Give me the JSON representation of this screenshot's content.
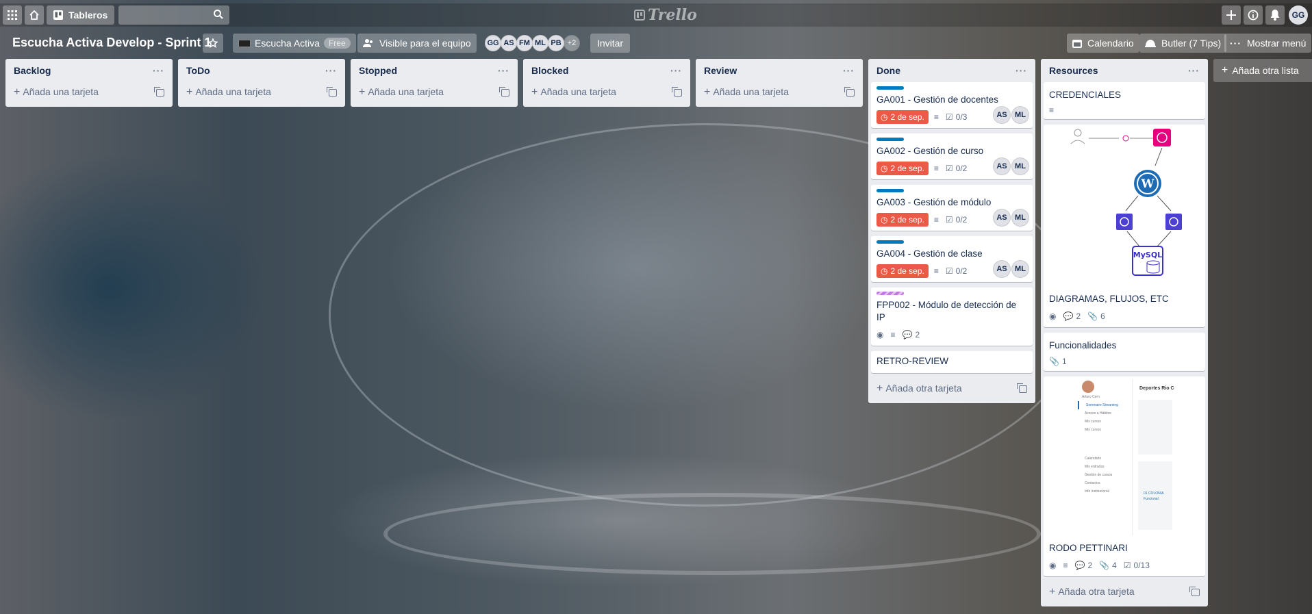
{
  "topbar": {
    "boards_label": "Tableros",
    "search_placeholder": "",
    "logo": "Trello",
    "user_initials": "GG"
  },
  "board": {
    "title": "Escucha Activa Develop - Sprint 1",
    "team_name": "Escucha Activa",
    "plan": "Free",
    "visibility": "Visible para el equipo",
    "members": [
      "GG",
      "AS",
      "FM",
      "ML",
      "PB"
    ],
    "members_more": "+2",
    "invite_label": "Invitar",
    "calendar_label": "Calendario",
    "butler_label": "Butler (7 Tips)",
    "menu_label": "Mostrar menú",
    "add_list_label": "Añada otra lista"
  },
  "colors": {
    "due_overdue": "#eb5a46",
    "label_blue": "#0079bf",
    "label_purple": "#c377e0"
  },
  "lists": [
    {
      "title": "Backlog",
      "add_label": "Añada una tarjeta"
    },
    {
      "title": "ToDo",
      "add_label": "Añada una tarjeta"
    },
    {
      "title": "Stopped",
      "add_label": "Añada una tarjeta"
    },
    {
      "title": "Blocked",
      "add_label": "Añada una tarjeta"
    },
    {
      "title": "Review",
      "add_label": "Añada una tarjeta"
    },
    {
      "title": "Done",
      "add_label": "Añada otra tarjeta",
      "cards": [
        {
          "title": "GA001 - Gestión de docentes",
          "due": "2 de sep.",
          "checklist": "0/3",
          "members": [
            "AS",
            "ML"
          ]
        },
        {
          "title": "GA002 - Gestión de curso",
          "due": "2 de sep.",
          "checklist": "0/2",
          "members": [
            "AS",
            "ML"
          ]
        },
        {
          "title": "GA003 - Gestión de módulo",
          "due": "2 de sep.",
          "checklist": "0/2",
          "members": [
            "AS",
            "ML"
          ]
        },
        {
          "title": "GA004 - Gestión de clase",
          "due": "2 de sep.",
          "checklist": "0/2",
          "members": [
            "AS",
            "ML"
          ]
        },
        {
          "title": "FPP002 - Módulo de detección de IP",
          "comments": "2"
        },
        {
          "title": "RETRO-REVIEW"
        }
      ]
    },
    {
      "title": "Resources",
      "add_label": "Añada otra tarjeta",
      "cards": [
        {
          "title": "CREDENCIALES"
        },
        {
          "title": "DIAGRAMAS, FLUJOS, ETC",
          "comments": "2",
          "attachments": "6",
          "cover": {
            "mysql": "MySQL"
          }
        },
        {
          "title": "Funcionalidades",
          "attachments": "1"
        },
        {
          "title": "RODO PETTINARI",
          "comments": "2",
          "attachments": "4",
          "checklist": "0/13",
          "cover": {
            "user": "Arturo Cern",
            "heading": "Deportes Rio C",
            "menu": [
              "Sommaire Streaming",
              "Acceso a Hábitos",
              "Mis cursos",
              "Mis cursos",
              "Calendario",
              "Mis entradas",
              "Gestión de cursos",
              "Contactos",
              "Info institucional"
            ],
            "legend": [
              "01 COLONIA",
              "Funcional"
            ]
          }
        }
      ]
    }
  ]
}
